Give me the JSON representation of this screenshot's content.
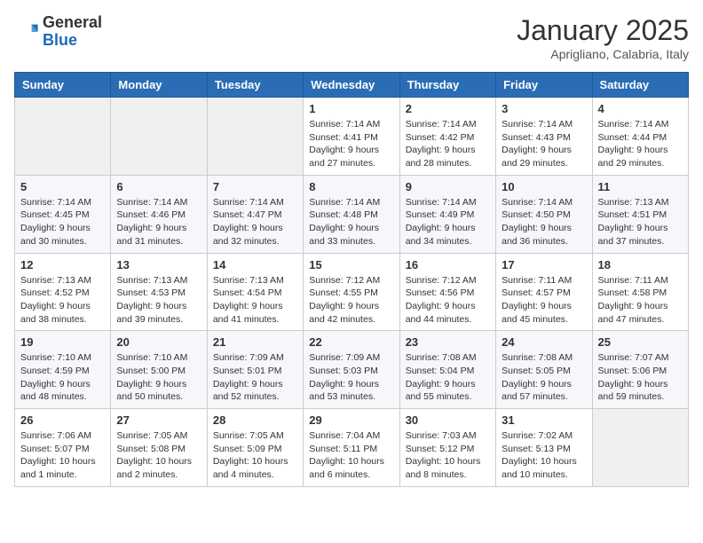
{
  "logo": {
    "general": "General",
    "blue": "Blue"
  },
  "header": {
    "month": "January 2025",
    "location": "Aprigliano, Calabria, Italy"
  },
  "weekdays": [
    "Sunday",
    "Monday",
    "Tuesday",
    "Wednesday",
    "Thursday",
    "Friday",
    "Saturday"
  ],
  "weeks": [
    [
      {
        "day": "",
        "info": ""
      },
      {
        "day": "",
        "info": ""
      },
      {
        "day": "",
        "info": ""
      },
      {
        "day": "1",
        "info": "Sunrise: 7:14 AM\nSunset: 4:41 PM\nDaylight: 9 hours and 27 minutes."
      },
      {
        "day": "2",
        "info": "Sunrise: 7:14 AM\nSunset: 4:42 PM\nDaylight: 9 hours and 28 minutes."
      },
      {
        "day": "3",
        "info": "Sunrise: 7:14 AM\nSunset: 4:43 PM\nDaylight: 9 hours and 29 minutes."
      },
      {
        "day": "4",
        "info": "Sunrise: 7:14 AM\nSunset: 4:44 PM\nDaylight: 9 hours and 29 minutes."
      }
    ],
    [
      {
        "day": "5",
        "info": "Sunrise: 7:14 AM\nSunset: 4:45 PM\nDaylight: 9 hours and 30 minutes."
      },
      {
        "day": "6",
        "info": "Sunrise: 7:14 AM\nSunset: 4:46 PM\nDaylight: 9 hours and 31 minutes."
      },
      {
        "day": "7",
        "info": "Sunrise: 7:14 AM\nSunset: 4:47 PM\nDaylight: 9 hours and 32 minutes."
      },
      {
        "day": "8",
        "info": "Sunrise: 7:14 AM\nSunset: 4:48 PM\nDaylight: 9 hours and 33 minutes."
      },
      {
        "day": "9",
        "info": "Sunrise: 7:14 AM\nSunset: 4:49 PM\nDaylight: 9 hours and 34 minutes."
      },
      {
        "day": "10",
        "info": "Sunrise: 7:14 AM\nSunset: 4:50 PM\nDaylight: 9 hours and 36 minutes."
      },
      {
        "day": "11",
        "info": "Sunrise: 7:13 AM\nSunset: 4:51 PM\nDaylight: 9 hours and 37 minutes."
      }
    ],
    [
      {
        "day": "12",
        "info": "Sunrise: 7:13 AM\nSunset: 4:52 PM\nDaylight: 9 hours and 38 minutes."
      },
      {
        "day": "13",
        "info": "Sunrise: 7:13 AM\nSunset: 4:53 PM\nDaylight: 9 hours and 39 minutes."
      },
      {
        "day": "14",
        "info": "Sunrise: 7:13 AM\nSunset: 4:54 PM\nDaylight: 9 hours and 41 minutes."
      },
      {
        "day": "15",
        "info": "Sunrise: 7:12 AM\nSunset: 4:55 PM\nDaylight: 9 hours and 42 minutes."
      },
      {
        "day": "16",
        "info": "Sunrise: 7:12 AM\nSunset: 4:56 PM\nDaylight: 9 hours and 44 minutes."
      },
      {
        "day": "17",
        "info": "Sunrise: 7:11 AM\nSunset: 4:57 PM\nDaylight: 9 hours and 45 minutes."
      },
      {
        "day": "18",
        "info": "Sunrise: 7:11 AM\nSunset: 4:58 PM\nDaylight: 9 hours and 47 minutes."
      }
    ],
    [
      {
        "day": "19",
        "info": "Sunrise: 7:10 AM\nSunset: 4:59 PM\nDaylight: 9 hours and 48 minutes."
      },
      {
        "day": "20",
        "info": "Sunrise: 7:10 AM\nSunset: 5:00 PM\nDaylight: 9 hours and 50 minutes."
      },
      {
        "day": "21",
        "info": "Sunrise: 7:09 AM\nSunset: 5:01 PM\nDaylight: 9 hours and 52 minutes."
      },
      {
        "day": "22",
        "info": "Sunrise: 7:09 AM\nSunset: 5:03 PM\nDaylight: 9 hours and 53 minutes."
      },
      {
        "day": "23",
        "info": "Sunrise: 7:08 AM\nSunset: 5:04 PM\nDaylight: 9 hours and 55 minutes."
      },
      {
        "day": "24",
        "info": "Sunrise: 7:08 AM\nSunset: 5:05 PM\nDaylight: 9 hours and 57 minutes."
      },
      {
        "day": "25",
        "info": "Sunrise: 7:07 AM\nSunset: 5:06 PM\nDaylight: 9 hours and 59 minutes."
      }
    ],
    [
      {
        "day": "26",
        "info": "Sunrise: 7:06 AM\nSunset: 5:07 PM\nDaylight: 10 hours and 1 minute."
      },
      {
        "day": "27",
        "info": "Sunrise: 7:05 AM\nSunset: 5:08 PM\nDaylight: 10 hours and 2 minutes."
      },
      {
        "day": "28",
        "info": "Sunrise: 7:05 AM\nSunset: 5:09 PM\nDaylight: 10 hours and 4 minutes."
      },
      {
        "day": "29",
        "info": "Sunrise: 7:04 AM\nSunset: 5:11 PM\nDaylight: 10 hours and 6 minutes."
      },
      {
        "day": "30",
        "info": "Sunrise: 7:03 AM\nSunset: 5:12 PM\nDaylight: 10 hours and 8 minutes."
      },
      {
        "day": "31",
        "info": "Sunrise: 7:02 AM\nSunset: 5:13 PM\nDaylight: 10 hours and 10 minutes."
      },
      {
        "day": "",
        "info": ""
      }
    ]
  ]
}
